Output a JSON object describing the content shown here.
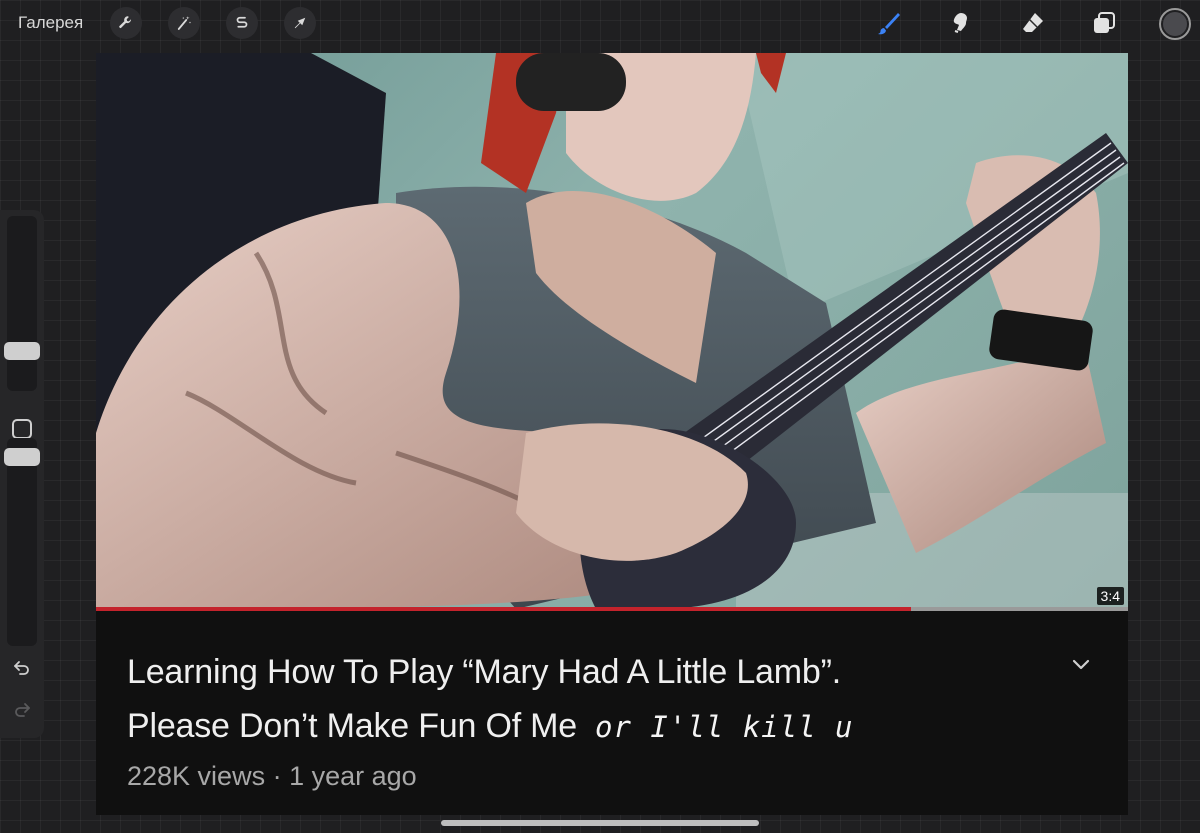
{
  "topbar": {
    "gallery_label": "Галерея",
    "left_tools": [
      "wrench-icon",
      "magic-wand-icon",
      "selection-icon",
      "transform-arrow-icon"
    ],
    "right_tools": [
      "brush-icon",
      "smudge-icon",
      "eraser-icon",
      "layers-icon"
    ],
    "active_tool_color": "#3b82f6",
    "current_color": "#4a4a4e"
  },
  "sidebar": {
    "brush_size_level": 0.2,
    "opacity_level": 0.05,
    "undo_icon": "undo-icon",
    "redo_icon": "redo-icon"
  },
  "video": {
    "duration": "3:4",
    "watched_fraction": 0.79,
    "progress_color": "#c4232c",
    "title_line1": "Learning How To Play “Mary Had A Little Lamb”.",
    "title_line2": "Please Don’t Make Fun Of Me",
    "handwritten_addition": "or I'll kill u",
    "stats": "228K views · 1 year ago"
  }
}
